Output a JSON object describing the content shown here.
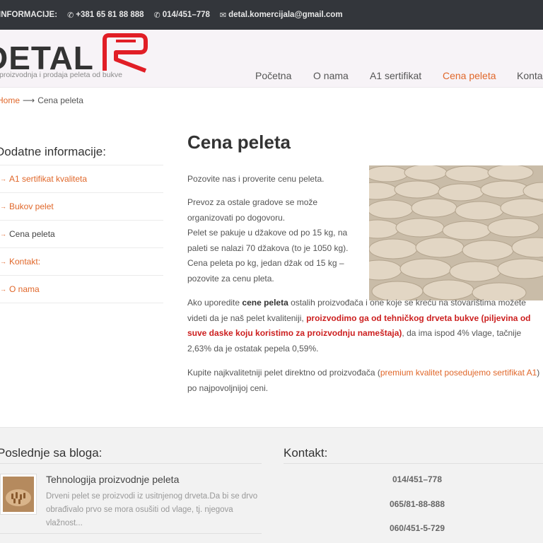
{
  "topbar": {
    "label": "INFORMACIJE:",
    "phone1": "+381 65 81 88 888",
    "phone2": "014/451–778",
    "email": "detal.komercijala@gmail.com"
  },
  "header": {
    "logo_text": "DETAL",
    "tagline": "proizvodnja i prodaja peleta od bukve",
    "brand_colors": {
      "logo_dark": "#333333",
      "logo_red": "#e11e26",
      "accent": "#e0672a"
    },
    "nav": [
      {
        "label": "Početna"
      },
      {
        "label": "O nama"
      },
      {
        "label": "A1 sertifikat"
      },
      {
        "label": "Cena peleta"
      },
      {
        "label": "Kontakt"
      }
    ]
  },
  "breadcrumb": {
    "home": "Home",
    "current": "Cena peleta"
  },
  "sidebar": {
    "title": "Dodatne informacije:",
    "items": [
      {
        "label": "A1 sertifikat kvaliteta"
      },
      {
        "label": "Bukov pelet"
      },
      {
        "label": "Cena peleta"
      },
      {
        "label": "Kontakt:"
      },
      {
        "label": "O nama"
      }
    ]
  },
  "main": {
    "title": "Cena peleta",
    "p1": "Pozovite nas i proverite cenu peleta.",
    "p2": "Prevoz za ostale gradove se može organizovati po dogovoru.",
    "p2b": "Pelet se pakuje u džakove od po 15 kg, na paleti se nalazi 70 džakova (to je 1050 kg).",
    "p2c": "Cena peleta po kg, jedan džak od 15 kg – pozovite za cenu pleta.",
    "p3_a": "Ako uporedite ",
    "p3_b": "cene peleta",
    "p3_c": " ostalih proizvođača i one koje se kreću na stovarištima možete videti da je naš pelet kvaliteniji, ",
    "p3_red": "proizvodimo ga od tehničkog drveta bukve (piljevina od suve daske koju koristimo za proizvodnju nameštaja)",
    "p3_d": ", da ima ispod 4% vlage, tačnije 2,63% da je ostatak pepela 0,59%.",
    "p4_a": "Kupite najkvalitetniji pelet direktno od proizvođača (",
    "p4_link": "premium kvalitet posedujemo sertifikat A1",
    "p4_b": ") po najpovoljnijoj ceni."
  },
  "footer": {
    "blog_title": "Poslednje sa bloga:",
    "post_title": "Tehnologija proizvodnje peleta",
    "post_excerpt": "Drveni pelet se proizvodi iz usitnjenog drveta.Da bi se drvo obrađivalo prvo se mora osušiti od vlage, tj. njegova vlažnost...",
    "contact_title": "Kontakt:",
    "phones": [
      "014/451–778",
      "065/81-88-888",
      "060/451-5-729"
    ]
  }
}
